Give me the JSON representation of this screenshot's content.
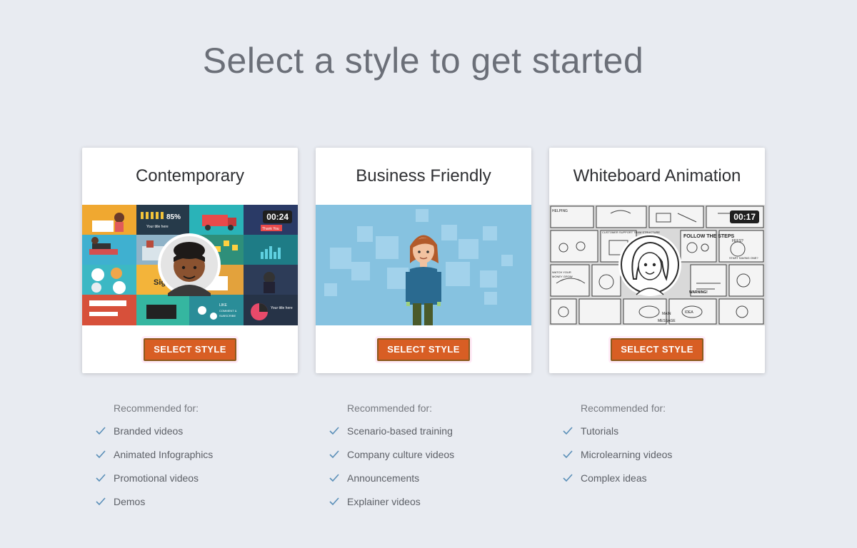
{
  "page": {
    "title": "Select a style to get started"
  },
  "cards": [
    {
      "title": "Contemporary",
      "duration": "00:24",
      "button_label": "SELECT STYLE",
      "recommended_heading": "Recommended for:",
      "recommended": [
        "Branded videos",
        "Animated Infographics",
        "Promotional videos",
        "Demos"
      ]
    },
    {
      "title": "Business Friendly",
      "duration": "",
      "button_label": "SELECT STYLE",
      "recommended_heading": "Recommended for:",
      "recommended": [
        "Scenario-based training",
        "Company culture videos",
        "Announcements",
        "Explainer videos"
      ]
    },
    {
      "title": "Whiteboard Animation",
      "duration": "00:17",
      "button_label": "SELECT STYLE",
      "recommended_heading": "Recommended for:",
      "recommended": [
        "Tutorials",
        "Microlearning videos",
        "Complex ideas"
      ]
    }
  ],
  "thumbnail_text": {
    "contemporary": {
      "stat": "85%",
      "title_here": "Your title here",
      "thank_you": "Thank You",
      "sign": "Sign",
      "like": "LIKE",
      "comment": "COMMENT &",
      "subscribe": "SUBSCRIBE",
      "title_here_2": "Your title here"
    },
    "whiteboard": {
      "helping": "HELPING",
      "structure": "CUSTOMER SUPPORT TEAM STRUCTURE",
      "follow": "FOLLOW THE STEPS",
      "fees": "FEES?",
      "warning": "WARNING!",
      "main": "MAIN",
      "message": "MESSAGE",
      "idea": "IDEA",
      "start_saving": "START SAVING ONE?",
      "watch": "WATCH YOUR",
      "grow": "MONEY GROW"
    }
  },
  "colors": {
    "background": "#e8ebf1",
    "button": "#d85e24",
    "check": "#5a8fb8"
  }
}
